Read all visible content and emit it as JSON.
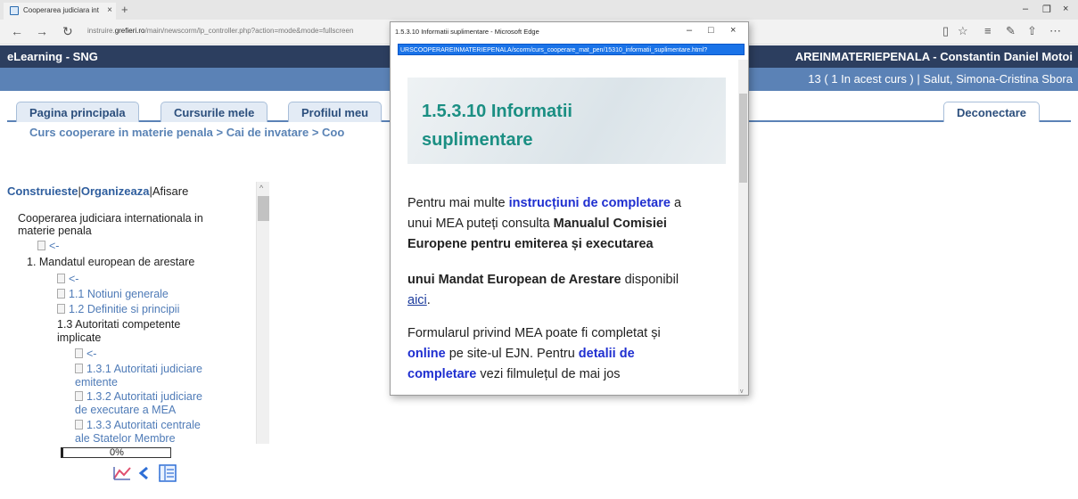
{
  "browser": {
    "tab_title": "Cooperarea judiciara int",
    "tab_close": "×",
    "new_tab": "+",
    "back": "←",
    "forward": "→",
    "refresh": "↻",
    "url_prefix": "instruire.",
    "url_domain": "grefieri.ro",
    "url_path": "/main/newscorm/lp_controller.php?action=mode&mode=fullscreen",
    "window_minimize": "–",
    "window_restore": "❐",
    "window_close": "×"
  },
  "site": {
    "title": "eLearning - SNG",
    "course_title": "AREINMATERIEPENALA - Constantin Daniel Motoi",
    "user_info": "13 ( 1 In acest curs ) | Salut, Simona-Cristina Sbora"
  },
  "nav": {
    "tabs": [
      "Pagina principala",
      "Cursurile mele",
      "Profilul meu"
    ],
    "logout": "Deconectare"
  },
  "breadcrumb": "Curs cooperare in materie penala > Cai de invatare > Coo",
  "mode": {
    "build": "Construieste",
    "sep1": "|",
    "organize": "Organizeaza",
    "sep2": "|",
    "display": "Afisare"
  },
  "toc": [
    {
      "text": "Cooperarea judiciara internationala in",
      "link": false
    },
    {
      "text": "materie penala",
      "link": false
    },
    {
      "text": "<-",
      "link": true
    },
    {
      "text": "1. Mandatul european de arestare",
      "link": false
    },
    {
      "text": "<-",
      "link": true
    },
    {
      "text": "1.1 Notiuni generale",
      "link": true
    },
    {
      "text": "1.2 Definitie si principii",
      "link": true
    },
    {
      "text": "1.3 Autoritati competente",
      "link": false
    },
    {
      "text": "implicate",
      "link": false
    },
    {
      "text": "<-",
      "link": true
    },
    {
      "text": "1.3.1 Autoritati judiciare",
      "link": true
    },
    {
      "text": "emitente",
      "link": true
    },
    {
      "text": "1.3.2 Autoritati judiciare",
      "link": true
    },
    {
      "text": "de executare a MEA",
      "link": true
    },
    {
      "text": "1.3.3 Autoritati centrale",
      "link": true
    },
    {
      "text": "ale Statelor Membre",
      "link": true
    }
  ],
  "progress": {
    "value": 0,
    "label": "0%"
  },
  "colors": {
    "header_bg": "#2c3e5f",
    "userbar_bg": "#5b82b6",
    "link_blue": "#4f7bb7",
    "popup_heading": "#1b8f83",
    "emphasis_blue": "#1f2fd0"
  },
  "popup": {
    "title": "1.5.3.10 Informatii suplimentare - Microsoft Edge",
    "url": "URSCOOPERAREINMATERIEPENALA/scorm/curs_cooperare_mat_pen/15310_informatii_suplimentare.html?",
    "heading_line1": "1.5.3.10 Informatii",
    "heading_line2": "suplimentare",
    "p1": {
      "a": "Pentru mai multe ",
      "b": "instrucțiuni de completare",
      "c": " a",
      "d": "unui MEA puteți consulta ",
      "e": "Manualul Comisiei",
      "f": "Europene pentru emiterea și executarea"
    },
    "p2": {
      "a": "unui Mandat European de Arestare",
      "b": " disponibil",
      "link": "aici",
      "c": "."
    },
    "p3": {
      "a": "Formularul privind MEA poate fi completat și",
      "b": "online",
      "c": " pe site-ul EJN. Pentru ",
      "d": "detalii de",
      "e": "completare",
      "f": " vezi filmulețul de mai jos"
    }
  }
}
